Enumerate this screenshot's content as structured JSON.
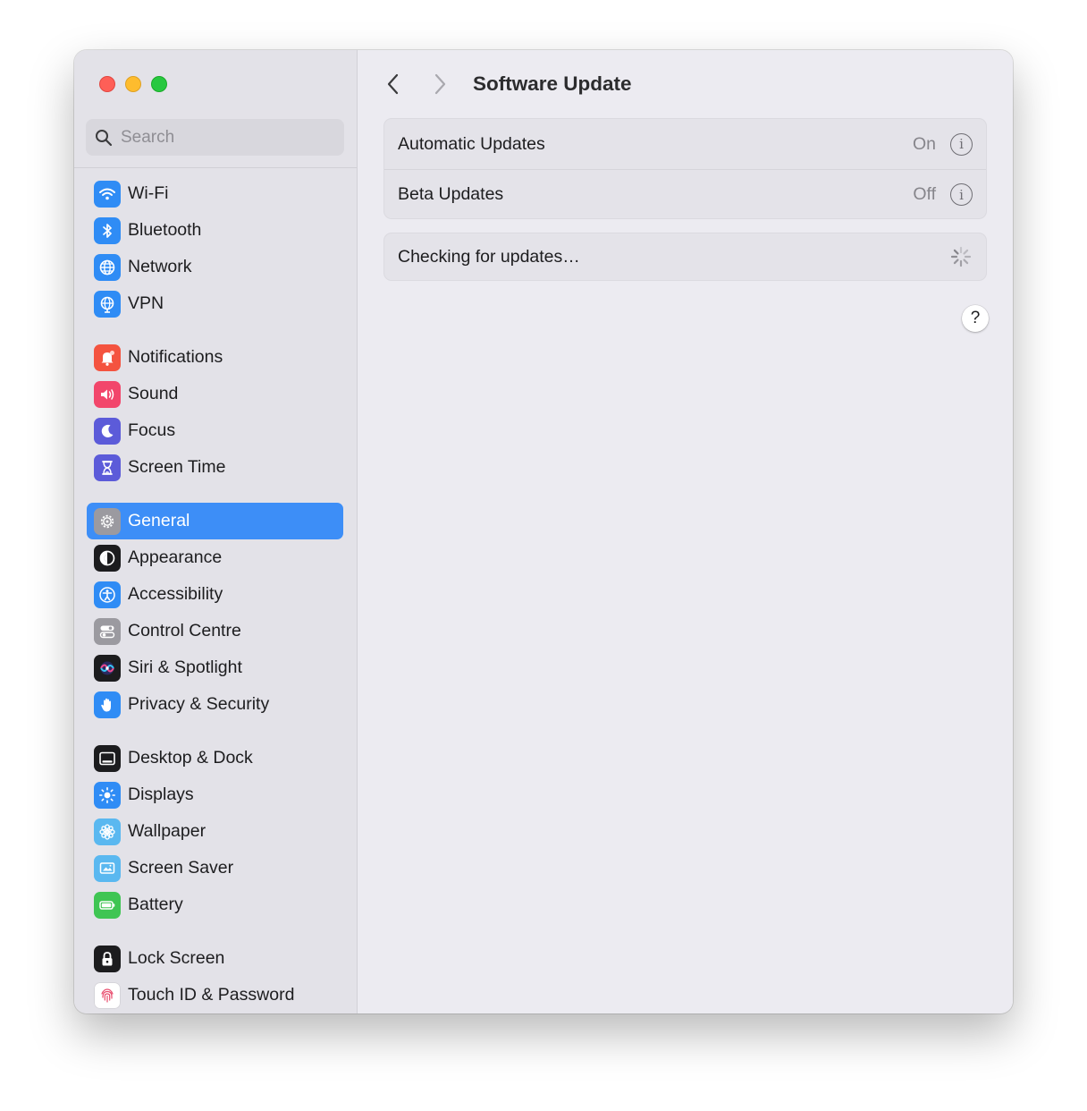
{
  "window": {
    "title": "Software Update"
  },
  "search": {
    "placeholder": "Search",
    "value": ""
  },
  "sidebar": {
    "selected": "General",
    "groups": [
      [
        {
          "label": "Wi-Fi",
          "icon": "wifi-icon",
          "color": "#2f8cf5"
        },
        {
          "label": "Bluetooth",
          "icon": "bluetooth-icon",
          "color": "#2f8cf5"
        },
        {
          "label": "Network",
          "icon": "globe-icon",
          "color": "#2f8cf5"
        },
        {
          "label": "VPN",
          "icon": "vpn-globe-icon",
          "color": "#2f8cf5"
        }
      ],
      [
        {
          "label": "Notifications",
          "icon": "bell-icon",
          "color": "#f4533f"
        },
        {
          "label": "Sound",
          "icon": "speaker-icon",
          "color": "#f2466b"
        },
        {
          "label": "Focus",
          "icon": "moon-icon",
          "color": "#5c5bd9"
        },
        {
          "label": "Screen Time",
          "icon": "hourglass-icon",
          "color": "#5c5bd9"
        }
      ],
      [
        {
          "label": "General",
          "icon": "gear-icon",
          "color": "#9b9aa0"
        },
        {
          "label": "Appearance",
          "icon": "appearance-icon",
          "color": "#1c1c1e"
        },
        {
          "label": "Accessibility",
          "icon": "accessibility-icon",
          "color": "#2f8cf5"
        },
        {
          "label": "Control Centre",
          "icon": "toggles-icon",
          "color": "#9b9aa0"
        },
        {
          "label": "Siri & Spotlight",
          "icon": "siri-icon",
          "color": "#1c1c1e"
        },
        {
          "label": "Privacy & Security",
          "icon": "hand-icon",
          "color": "#2f8cf5"
        }
      ],
      [
        {
          "label": "Desktop & Dock",
          "icon": "dock-icon",
          "color": "#1c1c1e"
        },
        {
          "label": "Displays",
          "icon": "sun-icon",
          "color": "#2f8cf5"
        },
        {
          "label": "Wallpaper",
          "icon": "flower-icon",
          "color": "#5ab8f0"
        },
        {
          "label": "Screen Saver",
          "icon": "screensaver-icon",
          "color": "#5ab8f0"
        },
        {
          "label": "Battery",
          "icon": "battery-icon",
          "color": "#3fc553"
        }
      ],
      [
        {
          "label": "Lock Screen",
          "icon": "lock-icon",
          "color": "#1c1c1e"
        },
        {
          "label": "Touch ID & Password",
          "icon": "fingerprint-icon",
          "color": "#ffffff"
        }
      ]
    ]
  },
  "main": {
    "updates": [
      {
        "label": "Automatic Updates",
        "value": "On"
      },
      {
        "label": "Beta Updates",
        "value": "Off"
      }
    ],
    "status": "Checking for updates…",
    "help": "?"
  },
  "colors": {
    "accent": "#3d8ef7",
    "sidebar_bg": "#e3e2e8",
    "main_bg": "#ecebf1"
  }
}
